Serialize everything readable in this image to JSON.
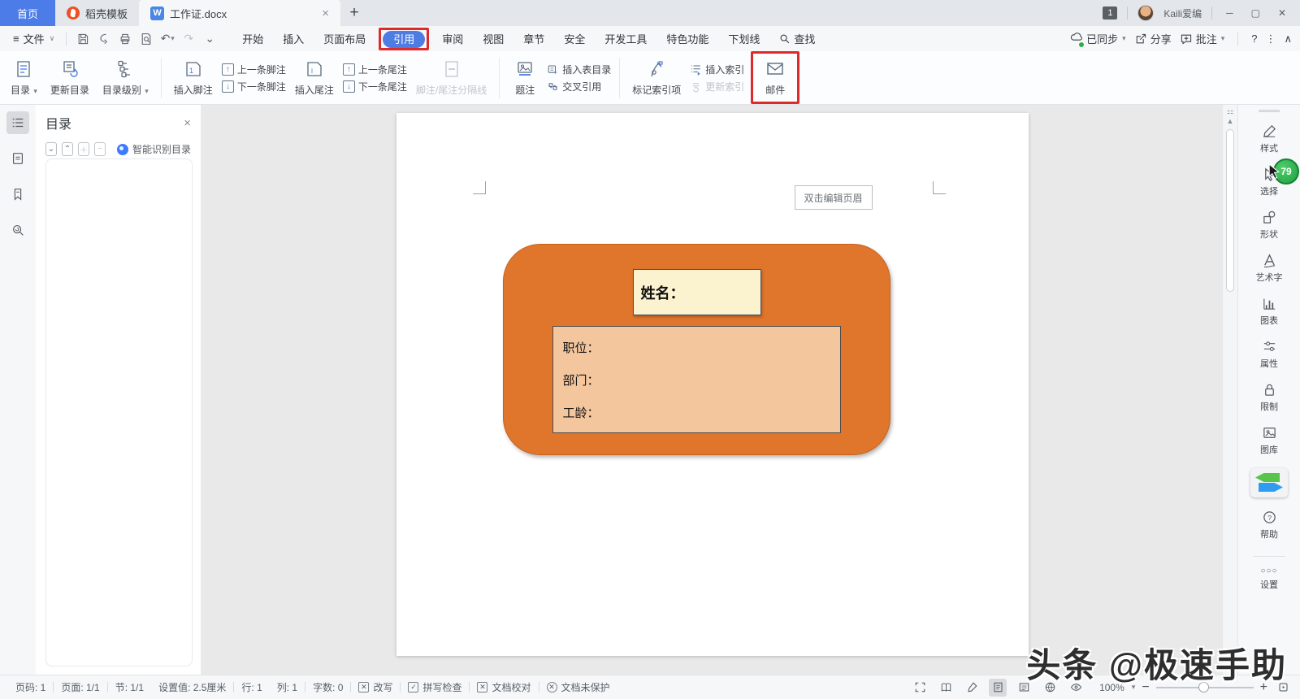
{
  "titlebar": {
    "home_tab": "首页",
    "docer_tab": "稻壳模板",
    "doc_tab": "工作证.docx",
    "doc_tab_icon_letter": "W",
    "doc_close": "×",
    "new_tab": "+",
    "session_badge": "1",
    "username": "Kaili爱编",
    "minimize": "─",
    "restore": "▢",
    "close": "✕"
  },
  "menubar": {
    "menu_toggle": "≡",
    "file": "文件",
    "file_caret": "∨",
    "items": [
      "开始",
      "插入",
      "页面布局",
      "引用",
      "审阅",
      "视图",
      "章节",
      "安全",
      "开发工具",
      "特色功能",
      "下划线"
    ],
    "find": "查找",
    "sync": "已同步",
    "share": "分享",
    "comment": "批注",
    "help": "?",
    "more": "⋮",
    "collapse": "∧",
    "undo_glyph": "↶",
    "redo_glyph": "↷",
    "caret": "▾",
    "chev": "⌄"
  },
  "ribbon": {
    "toc": "目录",
    "update_toc": "更新目录",
    "toc_level": "目录级别",
    "insert_footnote": "插入脚注",
    "prev_footnote": "上一条脚注",
    "next_footnote": "下一条脚注",
    "insert_endnote": "插入尾注",
    "prev_endnote": "上一条尾注",
    "next_endnote": "下一条尾注",
    "footnote_separator": "脚注/尾注分隔线",
    "caption": "题注",
    "insert_table_of_figures": "插入表目录",
    "cross_reference": "交叉引用",
    "mark_index_entry": "标记索引项",
    "insert_index": "插入索引",
    "update_index": "更新索引",
    "mail": "邮件",
    "caret": "▾",
    "up_arrow": "↑",
    "down_arrow": "↓"
  },
  "toc_panel": {
    "title": "目录",
    "close": "×",
    "btn_down": "⌄",
    "btn_up": "⌃",
    "btn_plus": "＋",
    "btn_minus": "−",
    "smart_label": "智能识别目录"
  },
  "document": {
    "header_hint": "双击编辑页眉",
    "name_label": "姓名：",
    "fields": [
      "职位：",
      "部门：",
      "工龄："
    ]
  },
  "sidebar": {
    "select_badge": "79",
    "items": [
      {
        "label": "样式"
      },
      {
        "label": "选择"
      },
      {
        "label": "形状"
      },
      {
        "label": "艺术字"
      },
      {
        "label": "图表"
      },
      {
        "label": "属性"
      },
      {
        "label": "限制"
      },
      {
        "label": "图库"
      },
      {
        "label": "帮助"
      },
      {
        "label": "设置"
      }
    ],
    "settings_dots": "○○○"
  },
  "statusbar": {
    "left": [
      "页码: 1",
      "页面: 1/1",
      "节: 1/1",
      "设置值: 2.5厘米",
      "行: 1",
      "列: 1",
      "字数: 0"
    ],
    "overwrite": "改写",
    "spellcheck": "拼写检查",
    "proofread": "文档校对",
    "protection": "文档未保护",
    "x_glyph": "✕",
    "check_glyph": "✓",
    "zoom": "100%",
    "zoom_caret": "▾",
    "zoom_minus": "−",
    "zoom_plus": "+"
  },
  "watermark": "头条 @极速手助",
  "colors": {
    "accent_blue": "#4d7ce3",
    "highlight_red": "#df2a2a",
    "card_orange": "#e0752c",
    "card_cream": "#fbf2d0",
    "card_salmon": "#f4c69e",
    "badge_green": "#27a93f",
    "home_tab_blue": "#4b7ce8"
  }
}
